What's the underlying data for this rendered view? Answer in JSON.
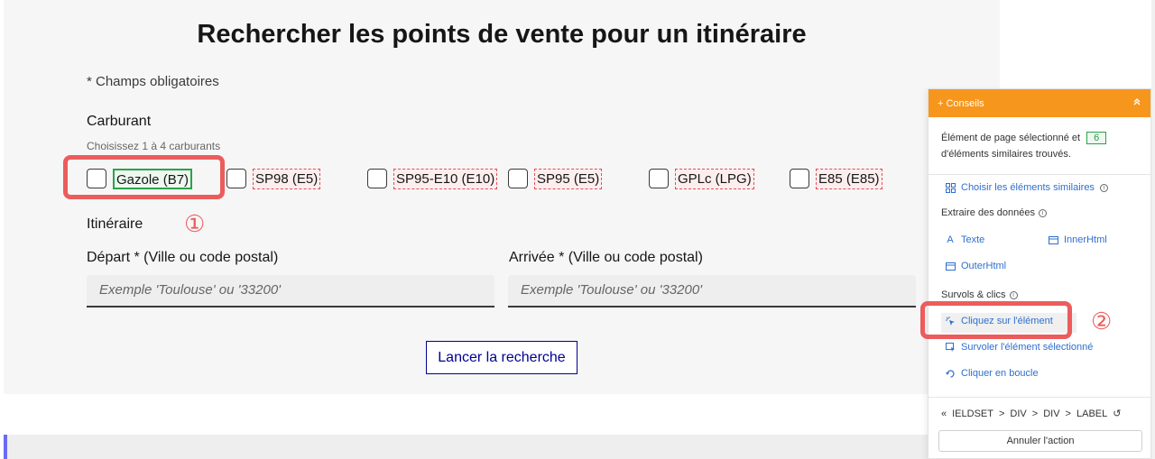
{
  "form": {
    "title": "Rechercher les points de vente pour un itinéraire",
    "required_note": "* Champs obligatoires",
    "fuel_label": "Carburant",
    "fuel_hint": "Choisissez 1 à 4 carburants",
    "fuels": [
      "Gazole (B7)",
      "SP98 (E5)",
      "SP95-E10 (E10)",
      "SP95 (E5)",
      "GPLc (LPG)",
      "E85 (E85)"
    ],
    "itinerary_label": "Itinéraire",
    "departure_label": "Départ * (Ville ou code postal)",
    "arrival_label": "Arrivée * (Ville ou code postal)",
    "departure_placeholder": "Exemple 'Toulouse' ou '33200'",
    "arrival_placeholder": "Exemple 'Toulouse' ou '33200'",
    "search_button": "Lancer la recherche"
  },
  "annotations": {
    "step1": "①",
    "step2": "②",
    "color": "#ec5c5c"
  },
  "extension": {
    "header_title": "+ Conseils",
    "collapse_icon": "chevron-double-up-icon",
    "info_text_before": "Élément de page sélectionné et",
    "similar_count": "6",
    "info_text_after": "d'éléments similaires trouvés.",
    "choose_similar": "Choisir les éléments similaires",
    "extract_heading": "Extraire des données",
    "text_link": "Texte",
    "innerhtml_link": "InnerHtml",
    "outerhtml_link": "OuterHtml",
    "hover_heading": "Survols & clics",
    "click_element": "Cliquez sur l'élément",
    "hover_selected": "Survoler l'élément sélectionné",
    "click_loop": "Cliquer en boucle",
    "breadcrumb": [
      "IELDSET",
      "DIV",
      "DIV",
      "LABEL"
    ],
    "cancel_button": "Annuler l'action",
    "accent_color": "#f7961c"
  }
}
